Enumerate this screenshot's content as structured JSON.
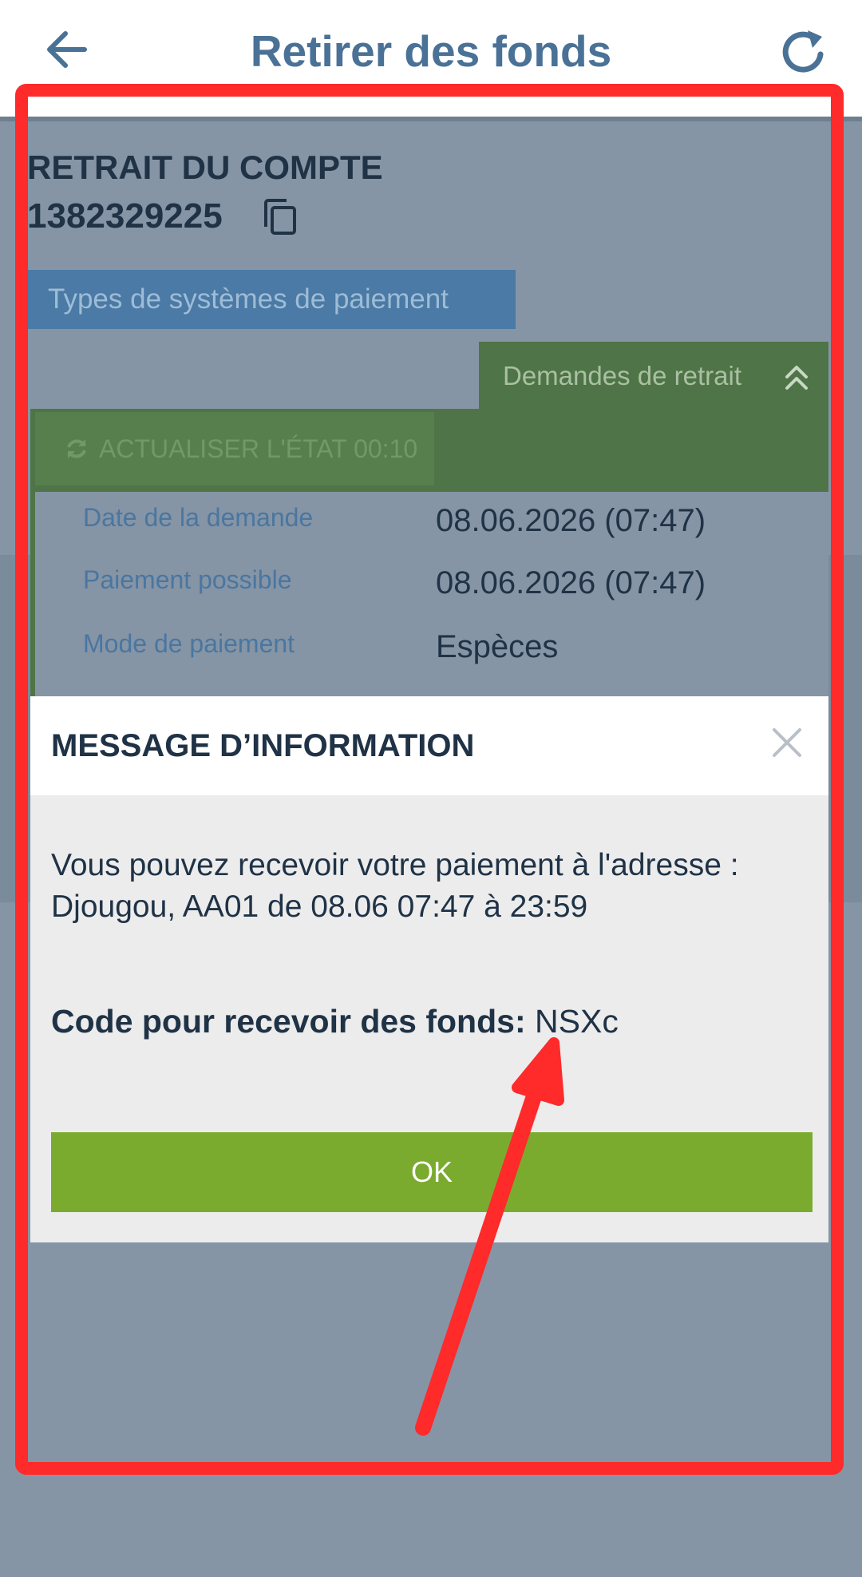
{
  "header": {
    "title": "Retirer des fonds",
    "back_icon": "arrow-left-icon",
    "refresh_icon": "refresh-icon"
  },
  "account": {
    "title": "RETRAIT DU COMPTE",
    "number": "1382329225",
    "copy_icon": "copy-icon"
  },
  "payment_types_label": "Types de systèmes de paiement",
  "withdraw_requests_tab": "Demandes de retrait",
  "refresh_status_label": "ACTUALISER L'ÉTAT 00:10",
  "details": [
    {
      "label": "Date de la demande",
      "value": "08.06.2026 (07:47)"
    },
    {
      "label": "Paiement possible",
      "value": "08.06.2026 (07:47)"
    },
    {
      "label": "Mode de paiement",
      "value": "Espèces"
    }
  ],
  "modal": {
    "title": "MESSAGE D’INFORMATION",
    "message": "Vous pouvez recevoir votre paiement à l'adresse : Djougou, AA01 de 08.06 07:47 à 23:59",
    "code_label": "Code pour recevoir des fonds:",
    "code_value": "NSXc",
    "ok_label": "OK"
  },
  "colors": {
    "accent_blue": "#4a7196",
    "dark_green": "#4f7447",
    "ok_green": "#7aab2f",
    "annotation_red": "#ff2a2a"
  }
}
